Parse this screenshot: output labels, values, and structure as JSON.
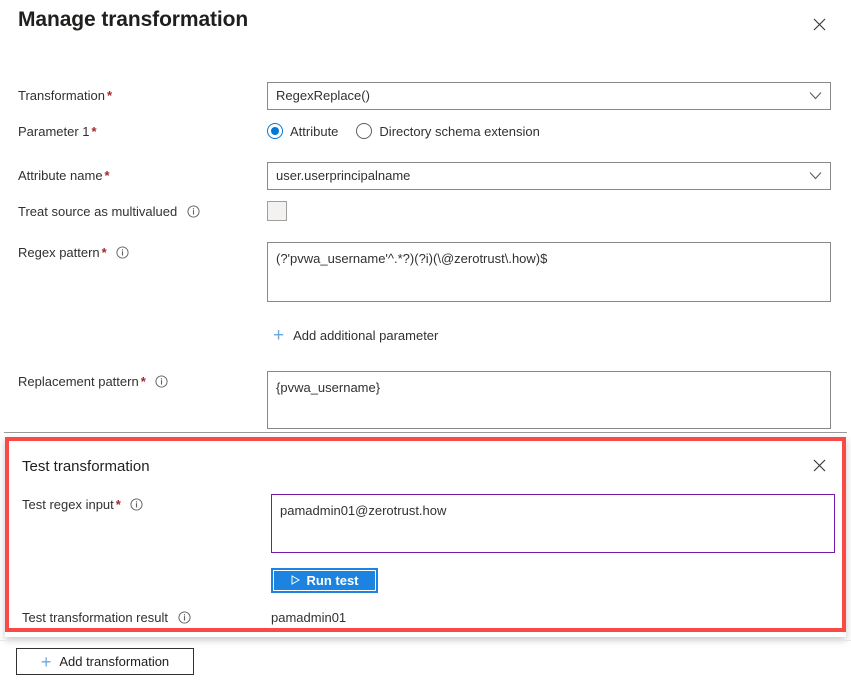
{
  "header": {
    "title": "Manage transformation",
    "close_icon": "close-icon"
  },
  "form": {
    "transformation": {
      "label": "Transformation",
      "required": "*",
      "value": "RegexReplace()",
      "chevron_icon": "chevron-down-icon"
    },
    "parameter1": {
      "label": "Parameter 1",
      "required": "*",
      "options": [
        {
          "label": "Attribute",
          "selected": true
        },
        {
          "label": "Directory schema extension",
          "selected": false
        }
      ]
    },
    "attribute_name": {
      "label": "Attribute name",
      "required": "*",
      "value": "user.userprincipalname",
      "chevron_icon": "chevron-down-icon"
    },
    "treat_source_as_multivalued": {
      "label": "Treat source as multivalued",
      "info_icon": "info-icon",
      "checked": false
    },
    "regex_pattern": {
      "label": "Regex pattern",
      "required": "*",
      "info_icon": "info-icon",
      "value": "(?'pvwa_username'^.*?)(?i)(\\@zerotrust\\.how)$"
    },
    "add_additional_parameter": {
      "label": "Add additional parameter",
      "plus_icon": "plus-icon"
    },
    "replacement_pattern": {
      "label": "Replacement pattern",
      "required": "*",
      "info_icon": "info-icon",
      "value": "{pvwa_username}"
    }
  },
  "test_transformation": {
    "title": "Test transformation",
    "close_icon": "close-icon",
    "highlight_color": "#f94a46",
    "test_regex_input": {
      "label": "Test regex input",
      "required": "*",
      "info_icon": "info-icon",
      "value": "pamadmin01@zerotrust.how",
      "focus_border_color": "#7719aa"
    },
    "run_test": {
      "label": "Run test",
      "play_icon": "play-icon",
      "color": "#1c84e0"
    },
    "test_result": {
      "label": "Test transformation result",
      "info_icon": "info-icon",
      "value": "pamadmin01"
    }
  },
  "footer": {
    "add_transformation": {
      "label": "Add transformation",
      "plus_icon": "plus-icon"
    }
  }
}
